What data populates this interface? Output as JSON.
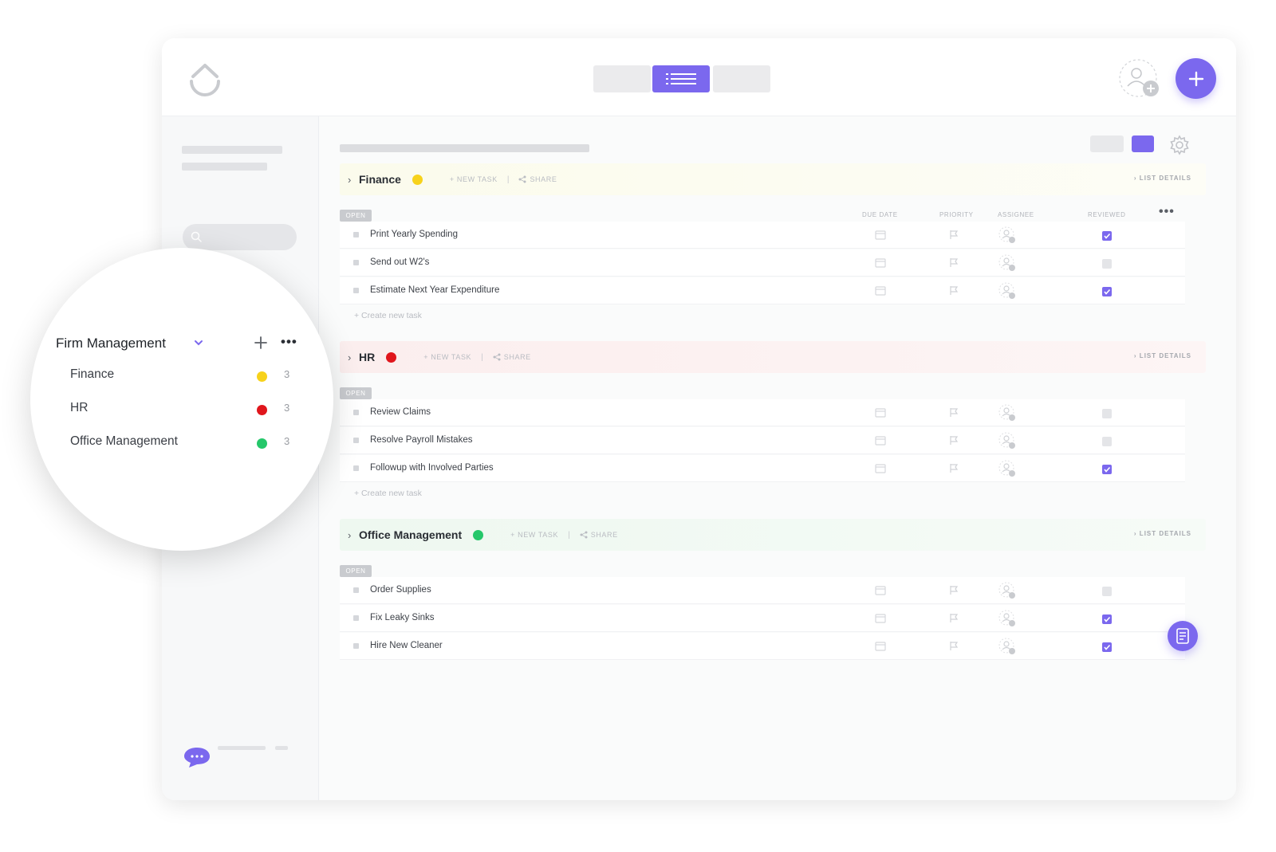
{
  "colors": {
    "accent": "#7b68ee",
    "finance": "#f7d21b",
    "hr": "#e0161c",
    "office": "#25c76a"
  },
  "sidebar": {
    "workspace": "Firm Management",
    "lists": [
      {
        "name": "Finance",
        "count": "3",
        "color": "#f7d21b"
      },
      {
        "name": "HR",
        "count": "3",
        "color": "#e0161c"
      },
      {
        "name": "Office Management",
        "count": "3",
        "color": "#25c76a"
      }
    ]
  },
  "columns": {
    "due_date": "DUE DATE",
    "priority": "PRIORITY",
    "assignee": "ASSIGNEE",
    "reviewed": "REVIEWED"
  },
  "status_label": "OPEN",
  "group_actions": {
    "new_task": "+ NEW TASK",
    "share": "SHARE",
    "list_details": "› LIST DETAILS",
    "create_task": "+  Create new task"
  },
  "groups": [
    {
      "name": "Finance",
      "color": "#f7d21b",
      "tasks": [
        {
          "name": "Print Yearly Spending",
          "reviewed": true
        },
        {
          "name": "Send out W2's",
          "reviewed": false
        },
        {
          "name": "Estimate Next Year Expenditure",
          "reviewed": true
        }
      ]
    },
    {
      "name": "HR",
      "color": "#e0161c",
      "tasks": [
        {
          "name": "Review Claims",
          "reviewed": false
        },
        {
          "name": "Resolve Payroll Mistakes",
          "reviewed": false
        },
        {
          "name": "Followup with Involved Parties",
          "reviewed": true
        }
      ]
    },
    {
      "name": "Office Management",
      "color": "#25c76a",
      "tasks": [
        {
          "name": "Order Supplies",
          "reviewed": false
        },
        {
          "name": "Fix Leaky Sinks",
          "reviewed": true
        },
        {
          "name": "Hire New Cleaner",
          "reviewed": true
        }
      ]
    }
  ]
}
